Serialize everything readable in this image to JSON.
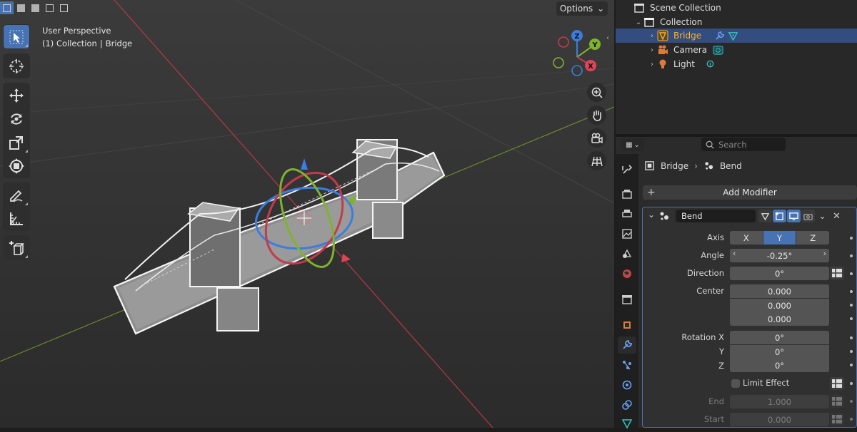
{
  "viewport": {
    "perspective_label": "User Perspective",
    "collection_label": "(1) Collection",
    "object_label": "Bridge",
    "options_label": "Options",
    "gizmo_axes": {
      "x": "X",
      "y": "Y",
      "z": "Z"
    }
  },
  "outliner": {
    "rows": [
      {
        "label": "Scene Collection",
        "icon": "scene-collection-icon"
      },
      {
        "label": "Collection",
        "icon": "collection-icon"
      },
      {
        "label": "Bridge",
        "icon": "mesh-object-icon",
        "selected": true
      },
      {
        "label": "Camera",
        "icon": "camera-object-icon"
      },
      {
        "label": "Light",
        "icon": "light-object-icon"
      }
    ]
  },
  "properties": {
    "search_placeholder": "Search",
    "breadcrumb": {
      "object": "Bridge",
      "modifier": "Bend"
    },
    "add_modifier_label": "Add Modifier",
    "modifier": {
      "name": "Bend",
      "axis_label": "Axis",
      "axis_options": [
        "X",
        "Y",
        "Z"
      ],
      "axis_selected": "Y",
      "angle_label": "Angle",
      "angle_value": "-0.25°",
      "direction_label": "Direction",
      "direction_value": "0°",
      "center_label": "Center",
      "center_values": [
        "0.000",
        "0.000",
        "0.000"
      ],
      "rotation_x_label": "Rotation X",
      "rotation_y_label": "Y",
      "rotation_z_label": "Z",
      "rotation_values": [
        "0°",
        "0°",
        "0°"
      ],
      "limit_effect_label": "Limit Effect",
      "end_label": "End",
      "end_value": "1.000",
      "start_label": "Start",
      "start_value": "0.000"
    }
  },
  "colors": {
    "accent": "#4772b3",
    "selected_object": "#ffaf29",
    "axis_x": "#c23b4b",
    "axis_y": "#6c8b2b",
    "axis_z": "#3b7de0"
  }
}
